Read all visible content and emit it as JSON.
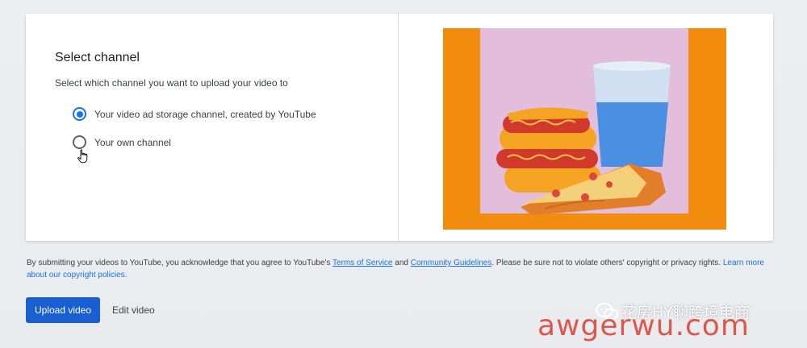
{
  "dialog": {
    "title": "Select channel",
    "subtitle": "Select which channel you want to upload your video to",
    "options": [
      {
        "label": "Your video ad storage channel, created by YouTube",
        "selected": true
      },
      {
        "label": "Your own channel",
        "selected": false
      }
    ]
  },
  "disclaimer": {
    "part1": "By submitting your videos to YouTube, you acknowledge that you agree to YouTube's ",
    "terms_link": "Terms of Service",
    "and": " and ",
    "guidelines_link": "Community Guidelines",
    "part2": ". Please be sure not to violate others' copyright or privacy rights. ",
    "learn_more_link": "Learn more about our copyright policies."
  },
  "actions": {
    "upload_label": "Upload video",
    "edit_label": "Edit video"
  },
  "watermark": {
    "line1": "花房HY聊跨境电商",
    "line2": "awgerwu.com"
  },
  "colors": {
    "accent": "#1a73e8",
    "primary_button": "#1a5fd1",
    "thumb_orange": "#f28c0f",
    "thumb_pink": "#e2bedc"
  },
  "icons": {
    "cursor": "hand-pointer-icon",
    "wechat": "wechat-icon"
  }
}
